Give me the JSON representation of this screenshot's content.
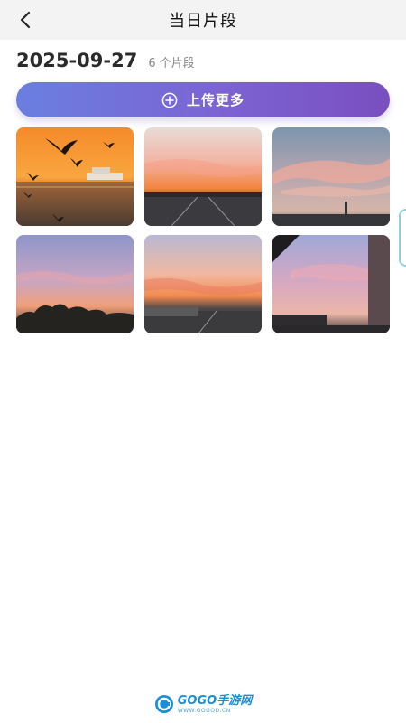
{
  "header": {
    "title": "当日片段"
  },
  "summary": {
    "date": "2025-09-27",
    "count_label": "6 个片段"
  },
  "upload_button": {
    "label": "上传更多"
  },
  "clips": [
    {
      "scene": "seagulls-boat-sunset"
    },
    {
      "scene": "highway-sunset"
    },
    {
      "scene": "pink-clouds-sky"
    },
    {
      "scene": "trees-sunset"
    },
    {
      "scene": "road-sunset-clouds"
    },
    {
      "scene": "building-sunset-sky"
    }
  ],
  "watermark": {
    "brand": "GOGO手游网",
    "url": "WWW.GOGOD.CN"
  },
  "colors": {
    "accent_start": "#6a7fe0",
    "accent_end": "#7a4fbf",
    "header_bg": "#f3f3f3"
  }
}
